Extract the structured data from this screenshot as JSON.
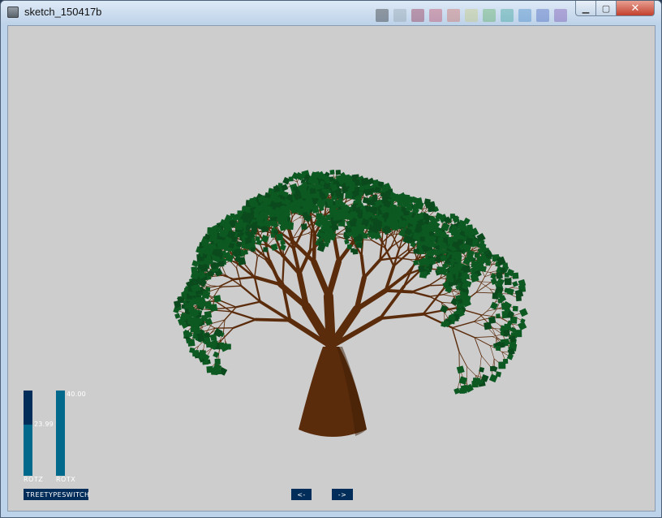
{
  "window": {
    "title": "sketch_150417b"
  },
  "titlebar": {
    "minimize_symbol": "▁",
    "maximize_symbol": "▢",
    "close_symbol": "✕"
  },
  "palette": [
    "#111111",
    "#8a9aa4",
    "#8a1030",
    "#c0304a",
    "#d05848",
    "#c8c86a",
    "#4aa84a",
    "#1e9a8c",
    "#2a78c0",
    "#3050b8",
    "#6a3aa8"
  ],
  "colors": {
    "canvas": "#cdcdcd",
    "bark": "#5b2c0c",
    "leaf": "#0c5a22",
    "control_bg": "#002d5a",
    "control_fill": "#00698c",
    "control_text": "#ffffff"
  },
  "controls": {
    "rotz": {
      "label": "ROTZ",
      "value": "23.99",
      "level": 0.6
    },
    "rotx": {
      "label": "ROTX",
      "value": "40.00",
      "level": 1.0
    },
    "treetype": {
      "label": "TREETYPESWITCH"
    },
    "prev": {
      "label": "<-"
    },
    "next": {
      "label": "->"
    }
  }
}
